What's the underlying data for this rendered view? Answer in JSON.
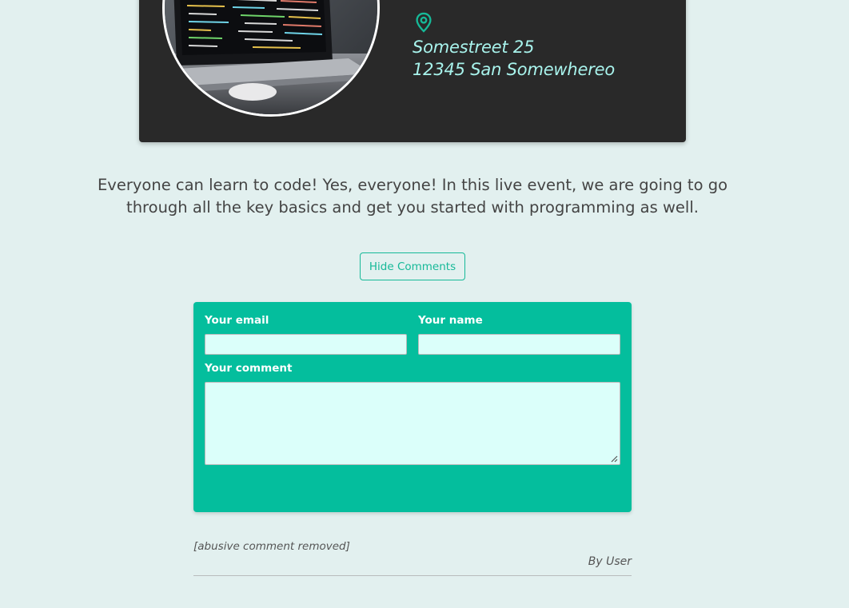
{
  "event": {
    "image_alt": "Laptop with code on screen",
    "address": {
      "street": "Somestreet 25",
      "city": "12345 San Somewhereo"
    },
    "description": "Everyone can learn to code! Yes, everyone! In this live event, we are going to go through all the key basics and get you started with programming as well."
  },
  "comments_toggle": {
    "label": "Hide Comments"
  },
  "comment_form": {
    "email_label": "Your email",
    "email_value": "",
    "name_label": "Your name",
    "name_value": "",
    "comment_label": "Your comment",
    "comment_value": ""
  },
  "comments": [
    {
      "text": "[abusive comment removed]",
      "author": "By User"
    }
  ],
  "colors": {
    "page_bg": "#e2f0ef",
    "card_bg": "#292929",
    "accent": "#16b998",
    "form_bg": "#04be9d",
    "address_text": "#a8f3ec",
    "input_bg": "#dbfffa"
  },
  "icons": {
    "location": "map-pin-icon",
    "resize": "resize-grip-icon"
  }
}
